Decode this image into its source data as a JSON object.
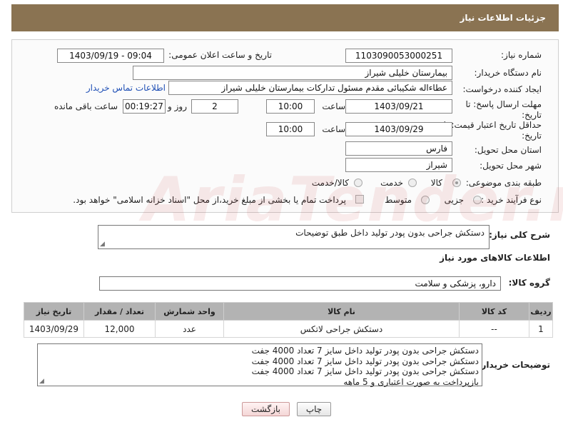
{
  "header": {
    "title": "جزئیات اطلاعات نیاز"
  },
  "fields": {
    "need_number_label": "شماره نیاز:",
    "need_number": "1103090053000251",
    "announce_label": "تاریخ و ساعت اعلان عمومی:",
    "announce_value": "1403/09/19 - 09:04",
    "buyer_org_label": "نام دستگاه خریدار:",
    "buyer_org": "بیمارستان خلیلی شیراز",
    "creator_label": "ایجاد کننده درخواست:",
    "creator": "عطاءاله شکیبائی مقدم مسئول تدارکات  بیمارستان خلیلی شیراز",
    "contact_link": "اطلاعات تماس خریدار",
    "deadline_label": "مهلت ارسال پاسخ: تا تاریخ:",
    "deadline_date": "1403/09/21",
    "time_label": "ساعت",
    "deadline_time": "10:00",
    "days_value": "2",
    "days_label": "روز و",
    "remaining_value": "00:19:27",
    "remaining_label": "ساعت باقی مانده",
    "price_label": "حداقل تاریخ اعتبار قیمت: تا تاریخ:",
    "price_date": "1403/09/29",
    "price_time": "10:00",
    "province_label": "استان محل تحویل:",
    "province": "فارس",
    "city_label": "شهر محل تحویل:",
    "city": "شیراز",
    "category_label": "طبقه بندی موضوعی:",
    "category_options": [
      "کالا",
      "خدمت",
      "کالا/خدمت"
    ],
    "category_selected": "کالا",
    "process_label": "نوع فرآیند خرید :",
    "process_options": [
      "جزیی",
      "متوسط"
    ],
    "treasury_note": "پرداخت تمام یا بخشی از مبلغ خرید،از محل \"اسناد خزانه اسلامی\" خواهد بود."
  },
  "summary": {
    "label": "شرح کلی نیاز:",
    "text": "دستکش جراحی بدون پودر تولید داخل طبق توضیحات"
  },
  "goods": {
    "section_title": "اطلاعات کالاهای مورد نیاز",
    "group_label": "گروه کالا:",
    "group_value": "دارو، پزشکی و سلامت",
    "columns": [
      "ردیف",
      "کد کالا",
      "نام کالا",
      "واحد شمارش",
      "تعداد / مقدار",
      "تاریخ نیاز"
    ],
    "rows": [
      [
        "1",
        "--",
        "دستکش جراحی لاتکس",
        "عدد",
        "12,000",
        "1403/09/29"
      ]
    ]
  },
  "buyer_notes": {
    "label": "توضیحات خریدار:",
    "lines": [
      "دستکش جراحی بدون پودر تولید داخل سایز 7 تعداد 4000 جفت",
      "دستکش جراحی بدون پودر تولید داخل سایز 7 تعداد 4000 جفت",
      "دستکش جراحی بدون پودر تولید داخل سایز 7 تعداد 4000 جفت",
      "بازپرداخت به صورت اعتباری و 5 ماهه"
    ]
  },
  "buttons": {
    "print": "چاپ",
    "back": "بازگشت"
  },
  "watermark": "AriaTender.neT"
}
